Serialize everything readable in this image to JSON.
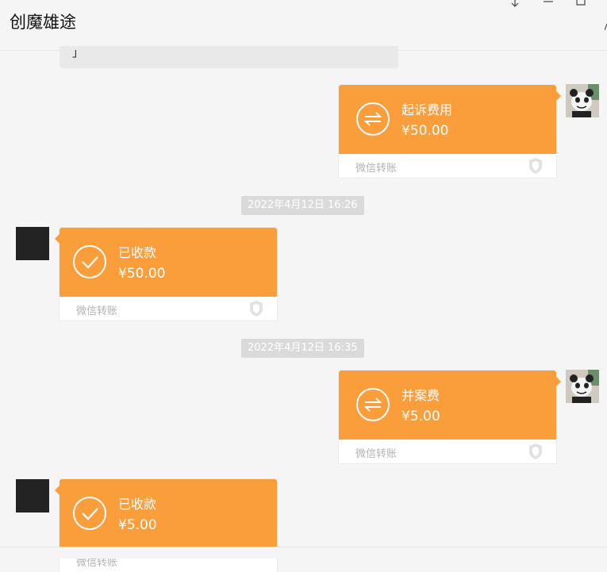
{
  "window": {
    "title": "创魔雄途",
    "pin_icon": "pin-icon",
    "minimize_icon": "minimize-icon",
    "maximize_icon": "maximize-icon"
  },
  "previous_message": {
    "text": "」"
  },
  "messages": [
    {
      "side": "right",
      "type": "transfer",
      "icon": "transfer-icon",
      "title": "起诉费用",
      "amount": "¥50.00",
      "footer": "微信转账"
    },
    {
      "type": "timestamp",
      "text": "2022年4月12日 16:26"
    },
    {
      "side": "left",
      "type": "transfer",
      "icon": "check-icon",
      "title": "已收款",
      "amount": "¥50.00",
      "footer": "微信转账"
    },
    {
      "type": "timestamp",
      "text": "2022年4月12日 16:35"
    },
    {
      "side": "right",
      "type": "transfer",
      "icon": "transfer-icon",
      "title": "并案费",
      "amount": "¥5.00",
      "footer": "微信转账"
    },
    {
      "side": "left",
      "type": "transfer",
      "icon": "check-icon",
      "title": "已收款",
      "amount": "¥5.00",
      "footer": "微信转账"
    }
  ],
  "colors": {
    "transfer_orange": "#fa9d3b",
    "timestamp_bg": "#dadada",
    "chat_bg": "#f5f5f5"
  }
}
